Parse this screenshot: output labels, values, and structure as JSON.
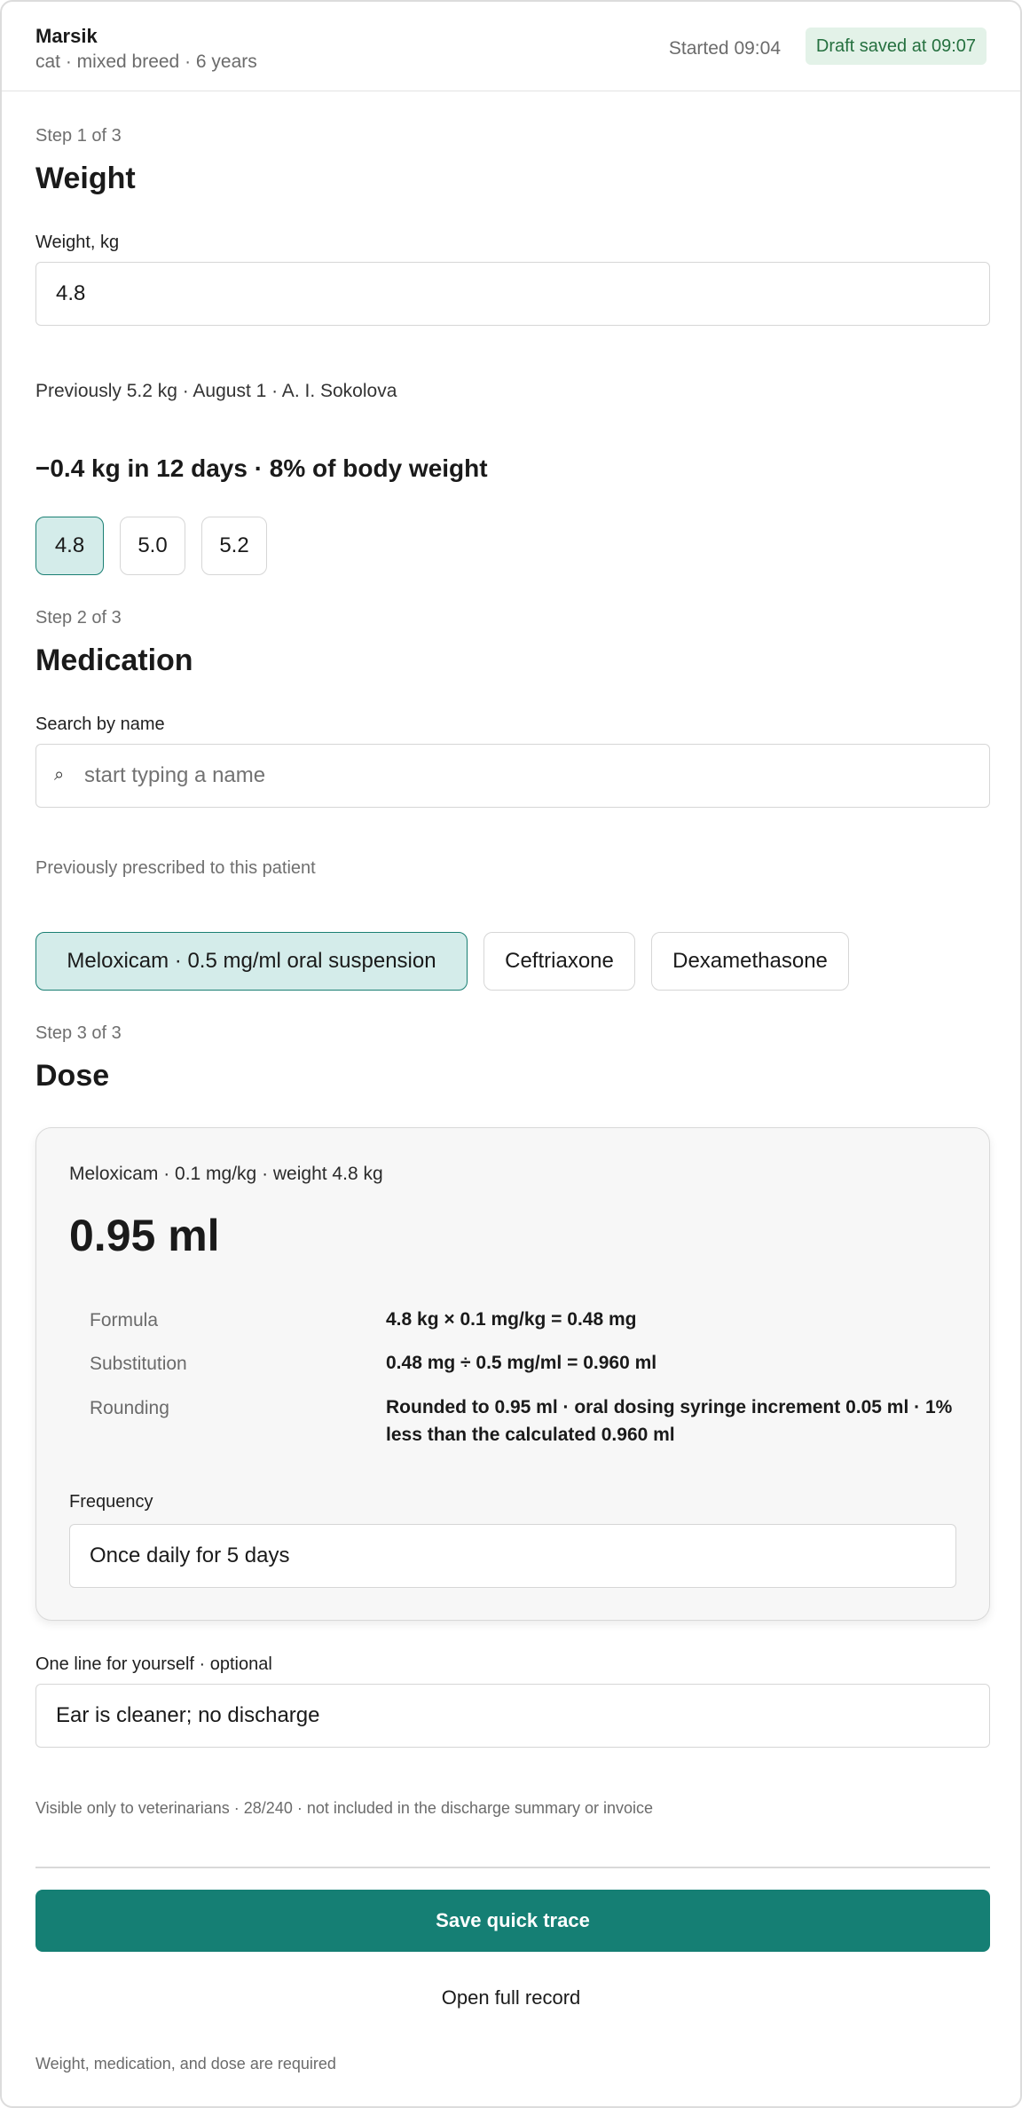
{
  "header": {
    "patient_name": "Marsik",
    "patient_meta": "cat · mixed breed · 6 years",
    "started": "Started 09:04",
    "draft_status": "Draft saved at 09:07"
  },
  "step1": {
    "step_label": "Step 1 of 3",
    "title": "Weight",
    "field_label": "Weight, kg",
    "weight_value": "4.8",
    "previous": "Previously 5.2 kg · August 1 · A. I. Sokolova",
    "delta": "−0.4 kg in 12 days · 8% of body weight",
    "chips": [
      "4.8",
      "5.0",
      "5.2"
    ],
    "selected_chip": "4.8"
  },
  "step2": {
    "step_label": "Step 2 of 3",
    "title": "Medication",
    "search_label": "Search by name",
    "search_placeholder": "start typing a name",
    "search_icon": "search-icon",
    "previous_label": "Previously prescribed to this patient",
    "chips": [
      "Meloxicam · 0.5 mg/ml oral suspension",
      "Ceftriaxone",
      "Dexamethasone"
    ],
    "selected_chip": "Meloxicam · 0.5 mg/ml oral suspension"
  },
  "step3": {
    "step_label": "Step 3 of 3",
    "title": "Dose",
    "dose_card": {
      "subtitle": "Meloxicam · 0.1 mg/kg · weight 4.8 kg",
      "dose": "0.95 ml",
      "rows": [
        {
          "key": "Formula",
          "value": "4.8 kg × 0.1 mg/kg = 0.48 mg"
        },
        {
          "key": "Substitution",
          "value": "0.48 mg ÷ 0.5 mg/ml = 0.960 ml"
        },
        {
          "key": "Rounding",
          "value": "Rounded to 0.95 ml · oral dosing syringe increment 0.05 ml · 1% less than the calculated 0.960 ml"
        }
      ],
      "frequency_label": "Frequency",
      "frequency_value": "Once daily for 5 days"
    }
  },
  "note": {
    "label": "One line for yourself · optional",
    "value": "Ear is cleaner; no discharge",
    "helper": "Visible only to veterinarians · 28/240 · not included in the discharge summary or invoice"
  },
  "actions": {
    "save_label": "Save quick trace",
    "open_full_label": "Open full record",
    "required_note": "Weight, medication, and dose are required"
  },
  "colors": {
    "accent": "#157f74",
    "chip_selected_bg": "#d4ecea",
    "draft_badge_bg": "#e3f2e8",
    "draft_badge_text": "#25703f"
  }
}
